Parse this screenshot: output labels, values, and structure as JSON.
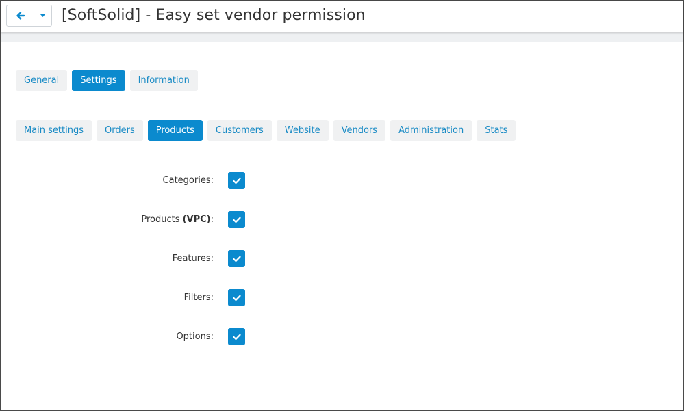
{
  "header": {
    "title": "[SoftSolid] - Easy set vendor permission",
    "back_icon": "arrow-left-icon",
    "caret_icon": "caret-down-icon"
  },
  "tabs": [
    {
      "label": "General",
      "active": false
    },
    {
      "label": "Settings",
      "active": true
    },
    {
      "label": "Information",
      "active": false
    }
  ],
  "subtabs": [
    {
      "label": "Main settings",
      "active": false
    },
    {
      "label": "Orders",
      "active": false
    },
    {
      "label": "Products",
      "active": true
    },
    {
      "label": "Customers",
      "active": false
    },
    {
      "label": "Website",
      "active": false
    },
    {
      "label": "Vendors",
      "active": false
    },
    {
      "label": "Administration",
      "active": false
    },
    {
      "label": "Stats",
      "active": false
    }
  ],
  "settings": [
    {
      "label": "Categories",
      "suffix": ":",
      "checked": true
    },
    {
      "label": "Products ",
      "bold": "(VPC)",
      "suffix": ":",
      "checked": true
    },
    {
      "label": "Features",
      "suffix": ":",
      "checked": true
    },
    {
      "label": "Filters",
      "suffix": ":",
      "checked": true
    },
    {
      "label": "Options",
      "suffix": ":",
      "checked": true
    }
  ],
  "colors": {
    "accent": "#0b8ace",
    "tab_bg": "#f0f1f2",
    "link": "#1a8bc5"
  }
}
